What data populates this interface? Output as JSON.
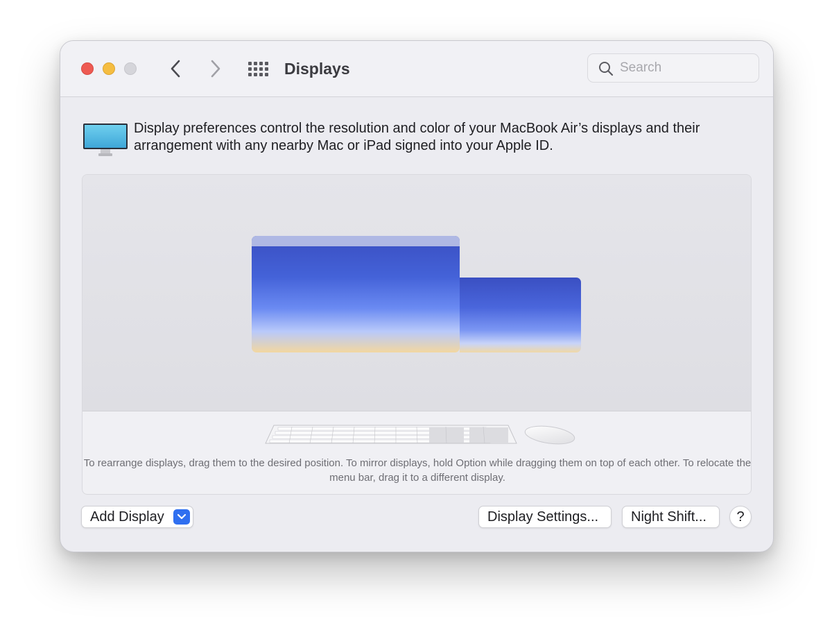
{
  "window": {
    "title": "Displays"
  },
  "search": {
    "placeholder": "Search",
    "value": ""
  },
  "info": {
    "text": "Display preferences control the resolution and color of your MacBook Air’s displays and their arrangement with any nearby Mac or iPad signed into your Apple ID."
  },
  "arrangement": {
    "hint": "To rearrange displays, drag them to the desired position. To mirror displays, hold Option while dragging them on top of each other. To relocate the menu bar, drag it to a different display."
  },
  "buttons": {
    "add_display": "Add Display",
    "display_settings": "Display Settings...",
    "night_shift": "Night Shift...",
    "help": "?"
  },
  "icons": {
    "back": "chevron-left-icon",
    "forward": "chevron-right-icon",
    "grid": "grid-icon",
    "search": "search-icon",
    "display": "display-icon",
    "dropdown": "chevron-down-icon"
  },
  "colors": {
    "accent": "#2f6ff0",
    "close": "#ee5a52",
    "minimize": "#f5bd41",
    "zoom_disabled": "#d5d5da"
  }
}
